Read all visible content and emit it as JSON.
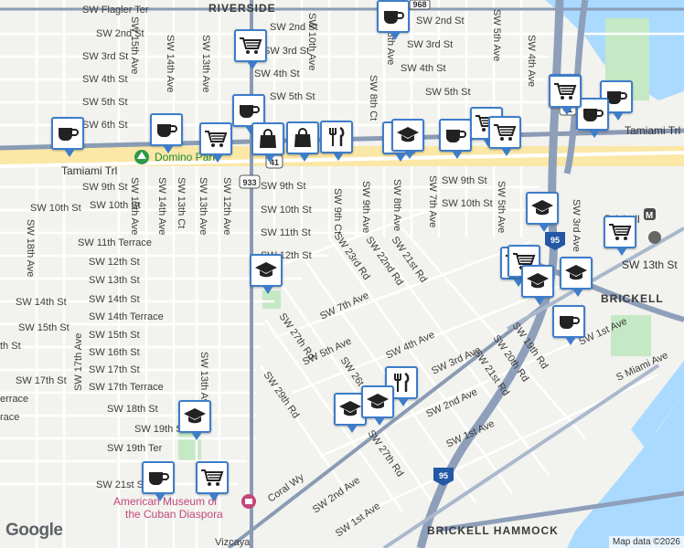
{
  "map": {
    "neighborhoods": [
      "RIVERSIDE",
      "BRICKELL",
      "BRICKELL HAMMOCK"
    ],
    "streets": {
      "sw_2nd_st": "SW 2nd St",
      "sw_3rd_st": "SW 3rd St",
      "sw_4th_st": "SW 4th St",
      "sw_5th_st": "SW 5th St",
      "sw_6th_st": "SW 6th St",
      "sw_9th_st": "SW 9th St",
      "sw_10th_st": "SW 10th St",
      "sw_11th_st": "SW 11th St",
      "sw_11th_terrace": "SW 11th Terrace",
      "sw_12th_st": "SW 12th St",
      "sw_13th_st": "SW 13th St",
      "sw_14th_st": "SW 14th St",
      "sw_14th_terrace": "SW 14th Terrace",
      "sw_15th_st": "SW 15th St",
      "sw_16th_st": "SW 16th St",
      "sw_17th_st": "SW 17th St",
      "sw_17th_terrace": "SW 17th Terrace",
      "sw_18th_st": "SW 18th St",
      "sw_19th_st": "SW 19th St",
      "sw_19th_ter": "SW 19th Ter",
      "sw_21st_st": "SW 21st St",
      "sw_flagler_ter": "SW Flagler Ter",
      "tamiami_trl": "Tamiami Trl",
      "sw_15th_ave": "SW 15th Ave",
      "sw_14th_ave": "SW 14th Ave",
      "sw_13th_ave": "SW 13th Ave",
      "sw_13th_ct": "SW 13th Ct",
      "sw_12th_ave": "SW 12th Ave",
      "sw_10th_ave": "SW 10th Ave",
      "sw_9th_ct": "SW 9th Ct",
      "sw_9th_ave": "SW 9th Ave",
      "sw_8th_ave": "SW 8th Ave",
      "sw_8th_ct": "SW 8th Ct",
      "sw_7th_ave": "SW 7th Ave",
      "sw_5th_ave": "SW 5th Ave",
      "sw_4th_ave": "SW 4th Ave",
      "sw_3rd_ave": "SW 3rd Ave",
      "sw_1st_ave": "SW 1st Ave",
      "sw_2nd_ave": "SW 2nd Ave",
      "sw_17th_ave": "SW 17th Ave",
      "sw_18th_ave": "SW 18th Ave",
      "sw_19th_rd": "SW 19th Rd",
      "sw_20th_rd": "SW 20th Rd",
      "sw_21st_rd": "SW 21st Rd",
      "sw_21st_rd_b": "SW 21st Rd",
      "sw_22nd_rd": "SW 22nd Rd",
      "sw_23rd_rd": "SW 23rd Rd",
      "sw_26th": "SW 26t",
      "sw_27th_rd": "SW 27th Rd",
      "sw_27th_rd_b": "SW 27th Rd",
      "sw_29th_rd": "SW 29th Rd",
      "s_miami_ave": "S Miami Ave",
      "coral_wy": "Coral Wy",
      "vizcaya": "Vizcaya",
      "th_st_edge": "th St",
      "terrace_edge": "errace",
      "erace_edge": "race",
      "tamiami_trl_right": "Tamiami Trl",
      "sw_13th_st_right": "SW 13th St",
      "brickell_label": "Brickell"
    },
    "shields": [
      "933",
      "41",
      "41",
      "95",
      "95",
      "968"
    ],
    "pois": {
      "domino_park": "Domino Park",
      "museum_line1": "American Museum of",
      "museum_line2": "the Cuban Diaspora"
    },
    "logo": "Google",
    "attribution": "Map data ©2026"
  },
  "markers": [
    {
      "type": "cafe-icon"
    },
    {
      "type": "cafe-icon"
    },
    {
      "type": "cafe-icon"
    },
    {
      "type": "cafe-icon"
    },
    {
      "type": "cafe-icon"
    },
    {
      "type": "cafe-icon"
    },
    {
      "type": "cafe-icon"
    },
    {
      "type": "cafe-icon"
    },
    {
      "type": "cafe-icon"
    },
    {
      "type": "cafe-icon"
    },
    {
      "type": "grocery-cart-icon"
    },
    {
      "type": "grocery-cart-icon"
    },
    {
      "type": "grocery-cart-icon"
    },
    {
      "type": "grocery-cart-icon"
    },
    {
      "type": "grocery-cart-icon"
    },
    {
      "type": "grocery-cart-icon"
    },
    {
      "type": "grocery-cart-icon"
    },
    {
      "type": "grocery-cart-icon"
    },
    {
      "type": "shopping-bag-icon"
    },
    {
      "type": "shopping-bag-icon"
    },
    {
      "type": "restaurant-icon"
    },
    {
      "type": "restaurant-icon"
    },
    {
      "type": "restaurant-icon"
    },
    {
      "type": "school-icon"
    },
    {
      "type": "school-icon"
    },
    {
      "type": "school-icon"
    },
    {
      "type": "school-icon"
    },
    {
      "type": "school-icon"
    },
    {
      "type": "school-icon"
    },
    {
      "type": "school-icon"
    },
    {
      "type": "school-icon"
    }
  ],
  "colors": {
    "marker_border": "#3d7dca",
    "highway": "#8a9bb5",
    "major_road": "#ffffff",
    "water": "#aadaff",
    "park": "#c5e8c5"
  }
}
